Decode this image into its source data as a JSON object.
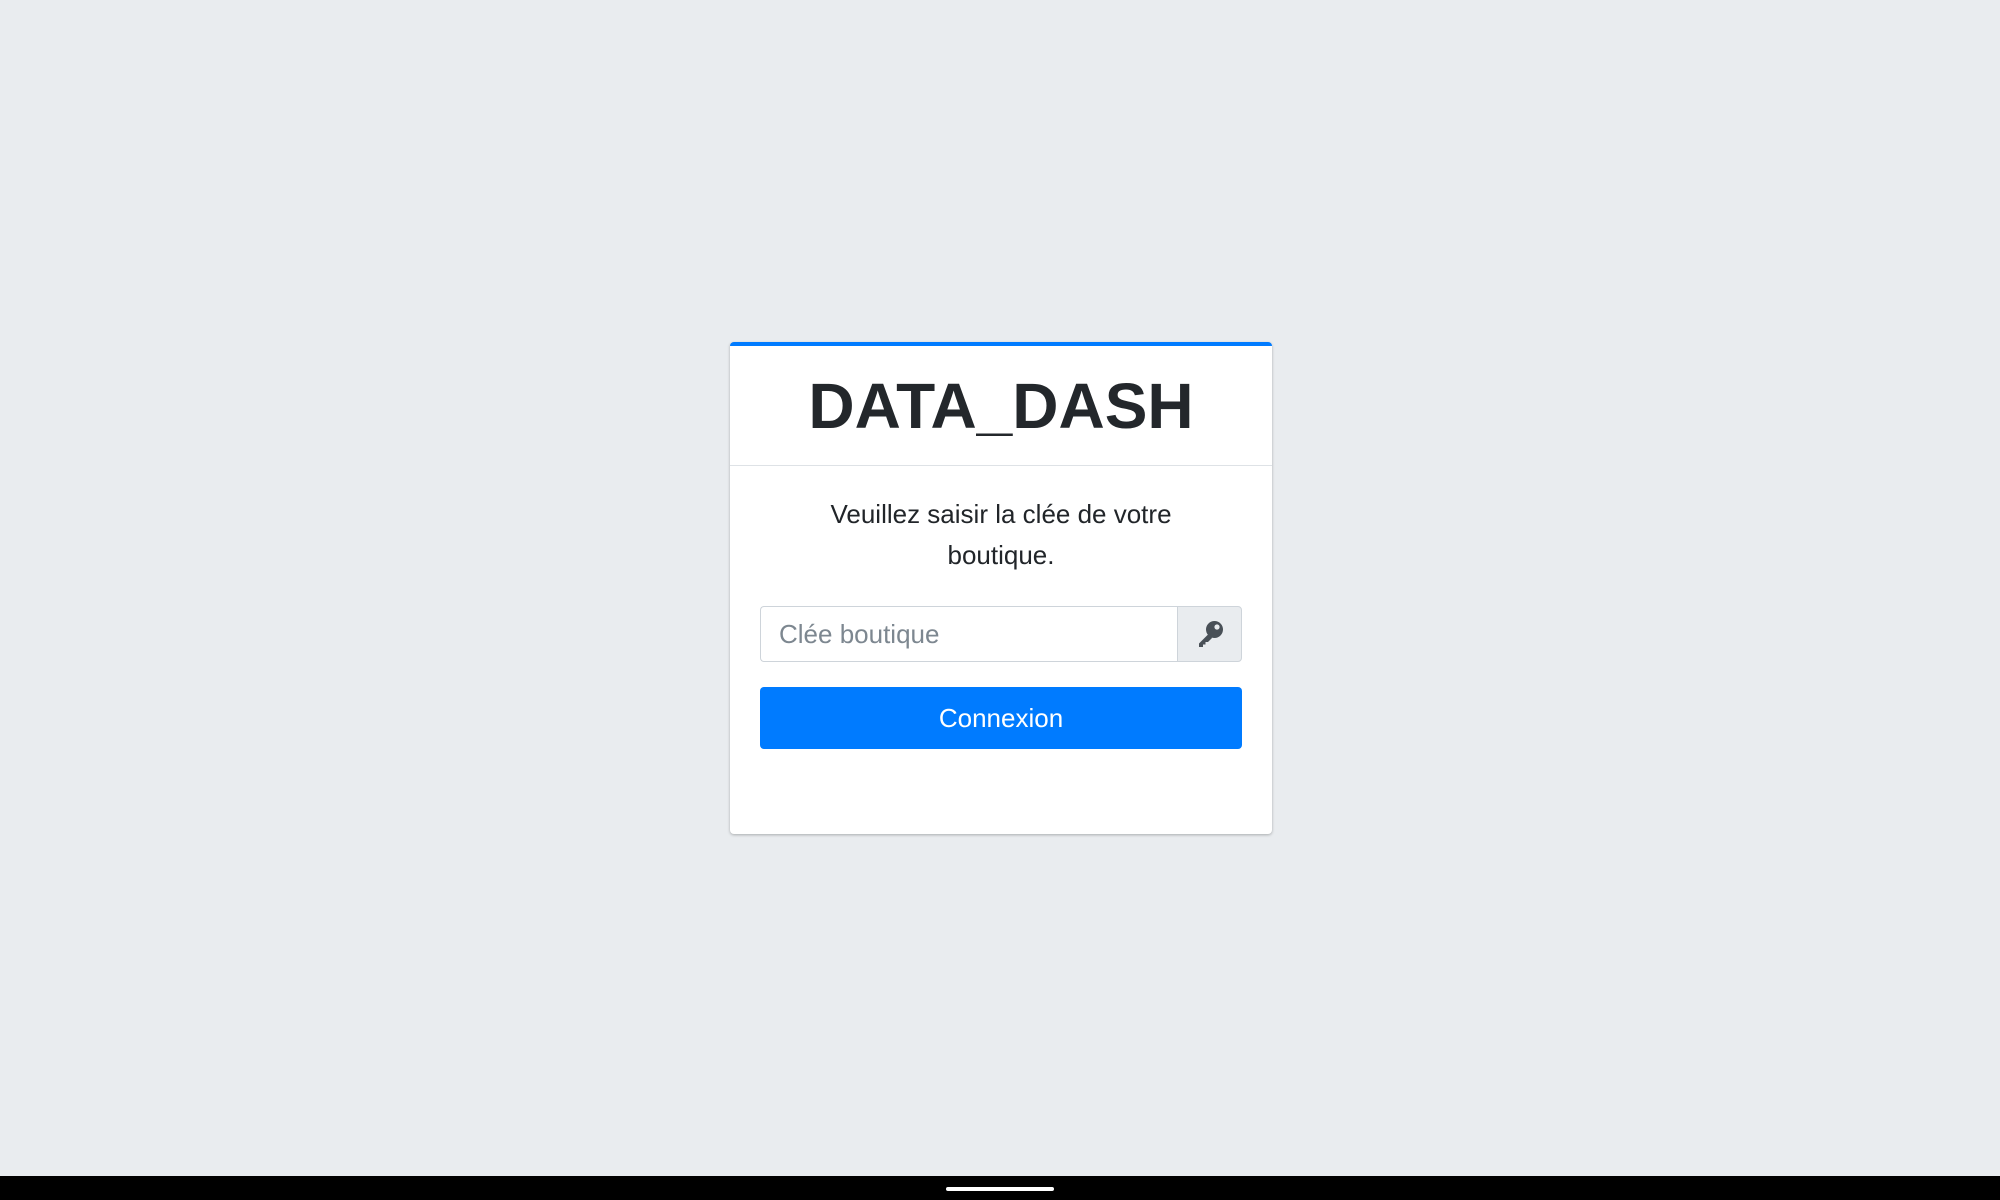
{
  "app": {
    "title": "DATA_DASH"
  },
  "login": {
    "message": "Veuillez saisir la clée de votre boutique.",
    "key_placeholder": "Clée boutique",
    "key_value": "",
    "key_icon": "key-icon",
    "submit_label": "Connexion"
  },
  "colors": {
    "accent": "#007bff",
    "background": "#e9ecef",
    "title_text": "#23272b"
  }
}
